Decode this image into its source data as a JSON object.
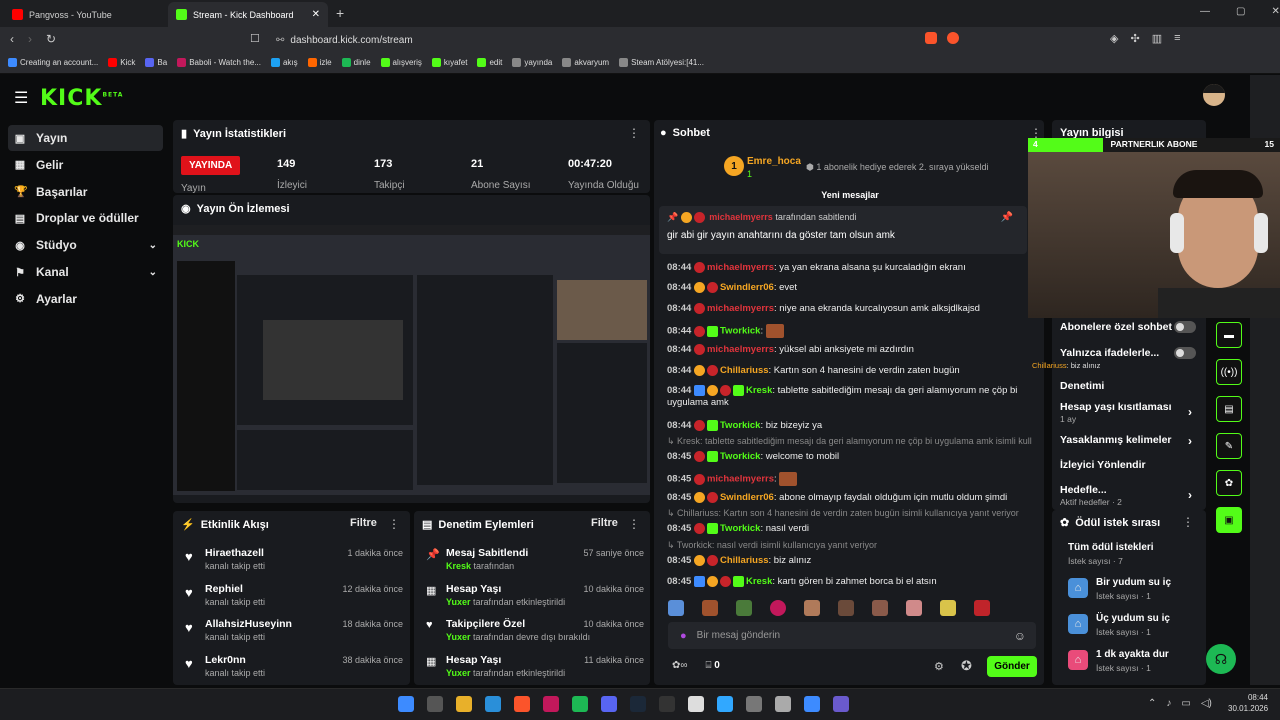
{
  "browser": {
    "tabs": [
      {
        "title": "Pangvoss - YouTube",
        "favicon_color": "#ff0000"
      },
      {
        "title": "Stream - Kick Dashboard",
        "favicon_color": "#53fc18"
      }
    ],
    "new_tab": "+",
    "url": "dashboard.kick.com/stream",
    "bookmarks": [
      "Creating an account...",
      "Kick",
      "Ba",
      "Baboli - Watch the...",
      "akış",
      "izle",
      "dinle",
      "alışveriş",
      "kıyafet",
      "edit",
      "yayında",
      "akvaryum",
      "Steam Atölyesi:[41..."
    ]
  },
  "kick": {
    "logo": "KICK",
    "beta": "BETA"
  },
  "sidebar": {
    "items": [
      {
        "label": "Yayın",
        "icon": "video-icon",
        "glyph": "▣"
      },
      {
        "label": "Gelir",
        "icon": "wallet-icon",
        "glyph": "▦"
      },
      {
        "label": "Başarılar",
        "icon": "trophy-icon",
        "glyph": "🏆"
      },
      {
        "label": "Droplar ve ödüller",
        "icon": "gift-icon",
        "glyph": "▤"
      },
      {
        "label": "Stüdyo",
        "icon": "studio-icon",
        "glyph": "◉"
      },
      {
        "label": "Kanal",
        "icon": "flag-icon",
        "glyph": "⚑"
      },
      {
        "label": "Ayarlar",
        "icon": "gear-icon",
        "glyph": "⚙"
      }
    ]
  },
  "stats": {
    "title": "Yayın İstatistikleri",
    "live_label": "YAYINDA",
    "live_sub": "Yayın",
    "items": [
      {
        "value": "149",
        "label": "İzleyici"
      },
      {
        "value": "173",
        "label": "Takipçi"
      },
      {
        "value": "21",
        "label": "Abone Sayısı"
      },
      {
        "value": "00:47:20",
        "label": "Yayında Olduğu"
      }
    ]
  },
  "preview": {
    "title": "Yayın Ön İzlemesi"
  },
  "activity": {
    "title": "Etkinlik Akışı",
    "filter": "Filtre",
    "items": [
      {
        "name": "Hiraethazell",
        "sub": "kanalı takip etti",
        "time": "1 dakika önce"
      },
      {
        "name": "Rephiel",
        "sub": "kanalı takip etti",
        "time": "12 dakika önce"
      },
      {
        "name": "AllahsizHuseyinn",
        "sub": "kanalı takip etti",
        "time": "18 dakika önce"
      },
      {
        "name": "Lekr0nn",
        "sub": "kanalı takip etti",
        "time": "38 dakika önce"
      }
    ]
  },
  "moderation": {
    "title": "Denetim Eylemleri",
    "filter": "Filtre",
    "items": [
      {
        "name": "Mesaj Sabitlendi",
        "actor": "Kresk",
        "sub": "tarafından",
        "time": "57 saniye önce",
        "icon": "pin-icon"
      },
      {
        "name": "Hesap Yaşı",
        "actor": "Yuxer",
        "sub": "tarafından etkinleştirildi",
        "time": "10 dakika önce",
        "icon": "calendar-icon"
      },
      {
        "name": "Takipçilere Özel",
        "actor": "Yuxer",
        "sub": "tarafından devre dışı bırakıldı",
        "time": "10 dakika önce",
        "icon": "heart-icon"
      },
      {
        "name": "Hesap Yaşı",
        "actor": "Yuxer",
        "sub": "tarafından etkinleştirildi",
        "time": "11 dakika önce",
        "icon": "calendar-icon"
      }
    ]
  },
  "chat": {
    "title": "Sohbet",
    "gift": {
      "user": "Emre_hoca",
      "count": "1",
      "text": "1 abonelik hediye ederek 2. sıraya yükseldi"
    },
    "new_messages": "Yeni mesajlar",
    "pinned": {
      "by": "michaelmyerrs",
      "by_suffix": "tarafından sabitlendi",
      "text": "gir abi gir yayın anahtarını da göster tam olsun amk"
    },
    "messages": [
      {
        "time": "08:44",
        "user": "michaelmyerrs",
        "color": "#e0343c",
        "text": ": ya yan ekrana alsana şu kurcaladığın ekranı"
      },
      {
        "time": "08:44",
        "user": "Swindlerr06",
        "color": "#f5a623",
        "text": ": evet"
      },
      {
        "time": "08:44",
        "user": "michaelmyerrs",
        "color": "#e0343c",
        "text": ": niye ana ekranda kurcalıyosun amk alksjdlkajsd"
      },
      {
        "time": "08:44",
        "user": "Tworkick",
        "color": "#53fc18",
        "text": ":"
      },
      {
        "time": "08:44",
        "user": "michaelmyerrs",
        "color": "#e0343c",
        "text": ": yüksel abi anksiyete mi azdırdın"
      },
      {
        "time": "08:44",
        "user": "Chillariuss",
        "color": "#f5a623",
        "text": ": Kartın son 4 hanesini de verdin zaten bugün"
      },
      {
        "time": "08:44",
        "user": "Kresk",
        "color": "#53fc18",
        "text": ": tablette sabitlediğim mesajı da geri alamıyorum ne çöp bi uygulama amk"
      },
      {
        "time": "08:44",
        "user": "Tworkick",
        "color": "#53fc18",
        "text": ": biz bizeyiz ya"
      },
      {
        "time": "08:45",
        "user": "Tworkick",
        "color": "#53fc18",
        "text": ": welcome to mobil",
        "reply": "Kresk: tablette sabitlediğim mesajı da geri alamıyorum ne çöp bi uygulama amk isimli kullan..."
      },
      {
        "time": "08:45",
        "user": "michaelmyerrs",
        "color": "#e0343c",
        "text": ":"
      },
      {
        "time": "08:45",
        "user": "Swindlerr06",
        "color": "#f5a623",
        "text": ": abone olmayıp faydalı olduğum için mutlu oldum şimdi"
      },
      {
        "time": "08:45",
        "user": "Tworkick",
        "color": "#53fc18",
        "text": ": nasıl verdi",
        "reply": "Chillariuss: Kartın son 4 hanesini de verdin zaten bugün isimli kullanıcıya yanıt veriyor"
      },
      {
        "time": "08:45",
        "user": "Chillariuss",
        "color": "#f5a623",
        "text": ": biz alınız",
        "reply": "Tworkick: nasıl verdi isimli kullanıcıya yanıt veriyor"
      },
      {
        "time": "08:45",
        "user": "Kresk",
        "color": "#53fc18",
        "text": ": kartı gören bi zahmet borca bi el atsın"
      }
    ],
    "input_placeholder": "Bir mesaj gönderin",
    "counter": "0",
    "send": "Gönder"
  },
  "stream_info": {
    "title": "Yayın bilgisi",
    "sub_banner": "PARTNERLIK ABONE",
    "sub_left": "4",
    "sub_right": "15"
  },
  "chat_settings": [
    {
      "label": "Abonelere özel sohbet",
      "type": "toggle"
    },
    {
      "label": "Yalnızca ifadelerle...",
      "type": "toggle"
    },
    {
      "label": "Denetimi",
      "type": "none"
    },
    {
      "label": "Hesap yaşı kısıtlaması",
      "sub": "1 ay",
      "type": "chevron"
    },
    {
      "label": "Yasaklanmış kelimeler",
      "type": "chevron"
    },
    {
      "label": "İzleyici Yönlendir",
      "type": "none"
    },
    {
      "label": "Hedefle...",
      "sub": "Aktif hedefler · 2",
      "type": "chevron"
    }
  ],
  "overlay_note": {
    "user": "Chillariuss",
    "text": "biz alınız"
  },
  "rewards": {
    "title": "Ödül istek sırası",
    "all": {
      "label": "Tüm ödül istekleri",
      "sub": "İstek sayısı · 7"
    },
    "items": [
      {
        "label": "Bir yudum su iç",
        "sub": "İstek sayısı · 1",
        "color": "#4a90d9"
      },
      {
        "label": "Üç yudum su iç",
        "sub": "İstek sayısı · 1",
        "color": "#4a90d9"
      },
      {
        "label": "1 dk ayakta dur",
        "sub": "İstek sayısı · 1",
        "color": "#e94b7a"
      }
    ]
  },
  "taskbar": {
    "time": "08:44",
    "date": "30.01.2026"
  }
}
